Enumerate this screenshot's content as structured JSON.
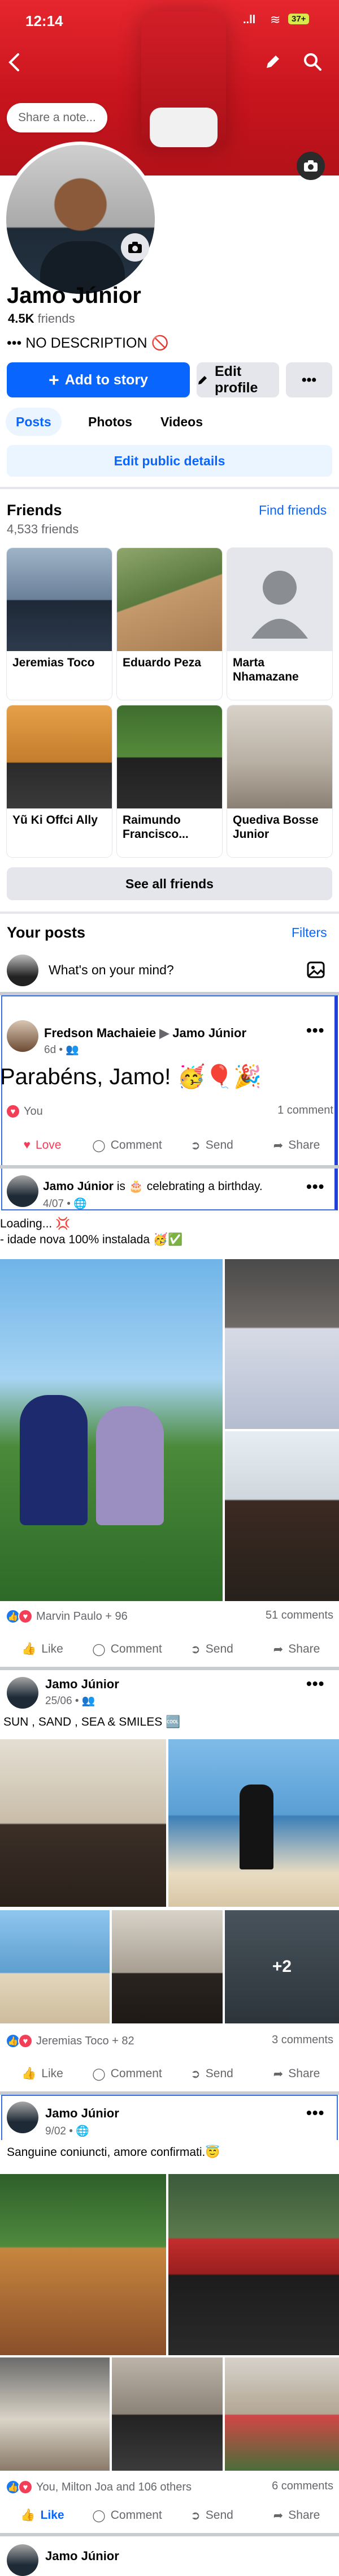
{
  "status_bar": {
    "time": "12:14",
    "signal": "..ll",
    "battery": "37+"
  },
  "profile": {
    "note_placeholder": "Share a note...",
    "name": "Jamo Júnior",
    "friends_count": "4.5K",
    "friends_label": "friends",
    "description": "••• NO DESCRIPTION 🚫",
    "add_to_story": "Add to story",
    "edit_profile": "Edit profile",
    "more": "•••"
  },
  "tabs": [
    "Posts",
    "Photos",
    "Videos"
  ],
  "edit_public_details": "Edit public details",
  "friends_section": {
    "title": "Friends",
    "count": "4,533 friends",
    "find_friends": "Find friends",
    "see_all": "See all friends",
    "friends": [
      {
        "name": "Jeremias Toco",
        "color": "#7a8fa6"
      },
      {
        "name": "Eduardo Peza",
        "color": "#6f8a5a"
      },
      {
        "name": "Marta Nhamazane",
        "color": "#c9ccd1"
      },
      {
        "name": "Yũ Ki Offci Ally",
        "color": "#d18a3a"
      },
      {
        "name": "Raimundo Francisco...",
        "color": "#3f6e2e"
      },
      {
        "name": "Quediva Bosse Junior",
        "color": "#b9b0a4"
      }
    ]
  },
  "your_posts": {
    "title": "Your posts",
    "filters": "Filters",
    "composer_placeholder": "What's on your mind?"
  },
  "post1": {
    "author": "Fredson Machaieie",
    "target": "Jamo Júnior",
    "time": "6d •",
    "text": "Parabéns, Jamo! 🥳🎈🎉",
    "reactor": "You",
    "comments": "1 comment",
    "actions": [
      "Love",
      "Comment",
      "Send",
      "Share"
    ]
  },
  "post2": {
    "author": "Jamo Júnior",
    "activity": "is 🎂 celebrating a birthday.",
    "time": "4/07 •",
    "line1": "Loading... 💢",
    "line2": "- idade nova 100% instalada 🥳✅",
    "reactions": "Marvin Paulo + 96",
    "comments": "51 comments",
    "actions": [
      "Like",
      "Comment",
      "Send",
      "Share"
    ]
  },
  "post3": {
    "author": "Jamo Júnior",
    "time": "25/06 •",
    "text": "SUN , SAND , SEA & SMILES 🆒",
    "more_photos": "+2",
    "reactions": "Jeremias Toco + 82",
    "comments": "3 comments",
    "actions": [
      "Like",
      "Comment",
      "Send",
      "Share"
    ]
  },
  "post4": {
    "author": "Jamo Júnior",
    "time": "9/02 •",
    "text": "Sanguine coniuncti, amore confirmati.😇",
    "reactions": "You, Milton Joa and 106 others",
    "comments": "6 comments",
    "actions": [
      "Like",
      "Comment",
      "Send",
      "Share"
    ]
  },
  "post5": {
    "author": "Jamo Júnior"
  },
  "colors": {
    "brand_blue": "#0866ff",
    "cover_red": "#d31e27"
  }
}
